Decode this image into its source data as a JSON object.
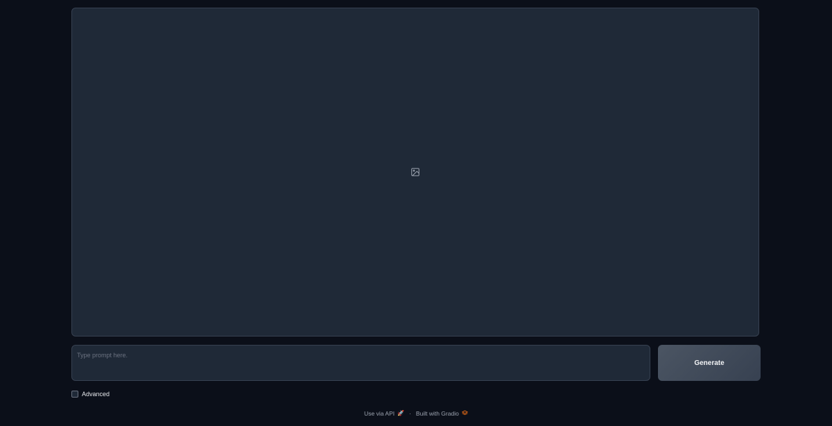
{
  "image_output": {
    "icon": "image-icon"
  },
  "prompt": {
    "placeholder": "Type prompt here.",
    "value": ""
  },
  "generate_button": {
    "label": "Generate"
  },
  "advanced": {
    "label": "Advanced",
    "checked": false
  },
  "footer": {
    "api_link": "Use via API",
    "api_icon": "rocket-icon",
    "separator": "·",
    "built_with": "Built with Gradio",
    "gradio_icon": "gradio-logo-icon"
  },
  "colors": {
    "background": "#0b0f19",
    "panel": "#1f2937",
    "border": "#374151",
    "accent": "#f97316"
  }
}
